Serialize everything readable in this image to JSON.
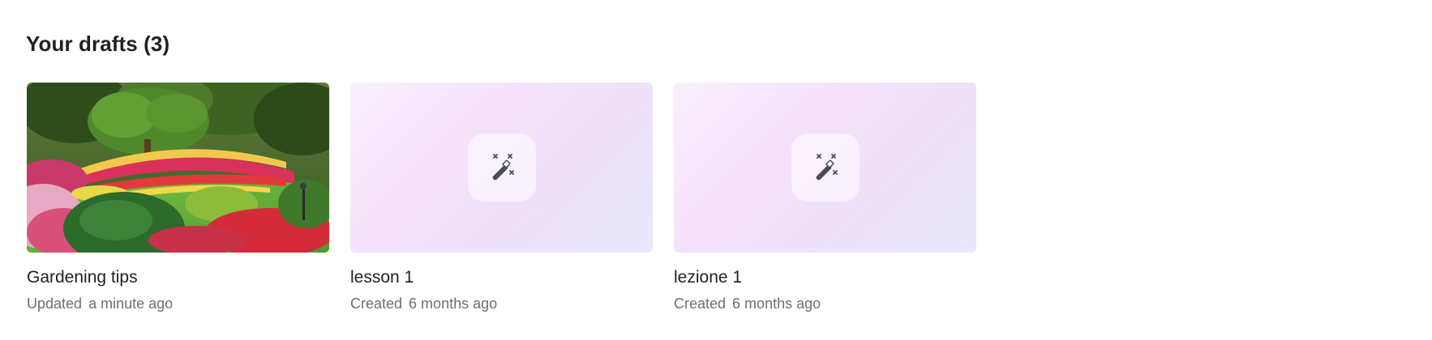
{
  "section": {
    "title": "Your drafts (3)"
  },
  "drafts": [
    {
      "title": "Gardening tips",
      "status": "Updated",
      "time": "a minute ago",
      "thumbnail": "garden-photo"
    },
    {
      "title": "lesson 1",
      "status": "Created",
      "time": "6 months ago",
      "thumbnail": "magic-wand-icon"
    },
    {
      "title": "lezione 1",
      "status": "Created",
      "time": "6 months ago",
      "thumbnail": "magic-wand-icon"
    }
  ],
  "colors": {
    "title_text": "#1e2025",
    "meta_text": "#6b6f76",
    "placeholder_gradient_start": "#f9f0fc",
    "placeholder_gradient_end": "#e7e8fb",
    "icon": "#4a4d56"
  }
}
